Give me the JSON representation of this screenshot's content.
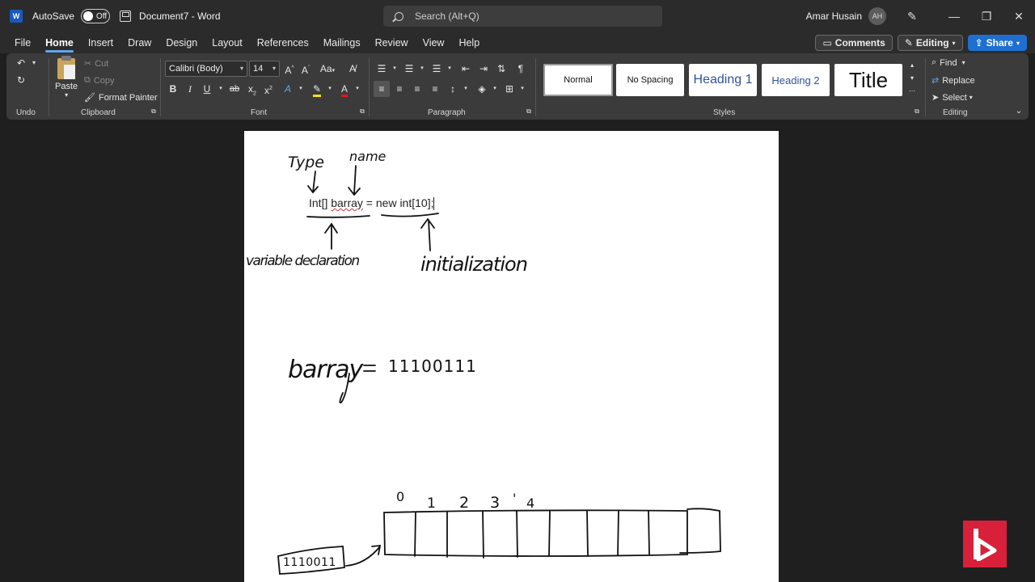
{
  "titlebar": {
    "app_badge": "W",
    "autosave_label": "AutoSave",
    "autosave_state": "Off",
    "document_title": "Document7 - Word",
    "search_placeholder": "Search (Alt+Q)",
    "user_name": "Amar Husain",
    "user_initials": "AH",
    "minimize": "—",
    "restore": "❐",
    "close": "✕"
  },
  "menu": {
    "tabs": [
      "File",
      "Home",
      "Insert",
      "Draw",
      "Design",
      "Layout",
      "References",
      "Mailings",
      "Review",
      "View",
      "Help"
    ],
    "comments_label": "Comments",
    "editing_label": "Editing",
    "share_label": "Share"
  },
  "ribbon": {
    "undo_group": "Undo",
    "clipboard": {
      "paste": "Paste",
      "cut": "Cut",
      "copy": "Copy",
      "format_painter": "Format Painter",
      "label": "Clipboard"
    },
    "font": {
      "family": "Calibri (Body)",
      "size": "14",
      "case": "Aa",
      "bold": "B",
      "italic": "I",
      "underline": "U",
      "strike": "ab",
      "subscript": "x",
      "superscript": "x",
      "label": "Font"
    },
    "paragraph": {
      "label": "Paragraph"
    },
    "styles": {
      "items": [
        "Normal",
        "No Spacing",
        "Heading 1",
        "Heading 2",
        "Title"
      ],
      "label": "Styles"
    },
    "editing": {
      "find": "Find",
      "replace": "Replace",
      "select": "Select",
      "label": "Editing"
    }
  },
  "document": {
    "line_prefix": "Int[] ",
    "line_var": "barray",
    "line_suffix": " = new int[10];",
    "ink_type": "Type",
    "ink_name": "name",
    "ink_declaration": "variable declaration",
    "ink_initialization": "initialization",
    "ink_barray": "barray",
    "ink_bits": "11100111",
    "ink_box": "1110011",
    "ink_indices": [
      "0",
      "1",
      "2",
      "3",
      "'",
      "4"
    ]
  },
  "colors": {
    "accent": "#5fa8e8",
    "share": "#1f6fd1",
    "brand": "#d9203a"
  }
}
